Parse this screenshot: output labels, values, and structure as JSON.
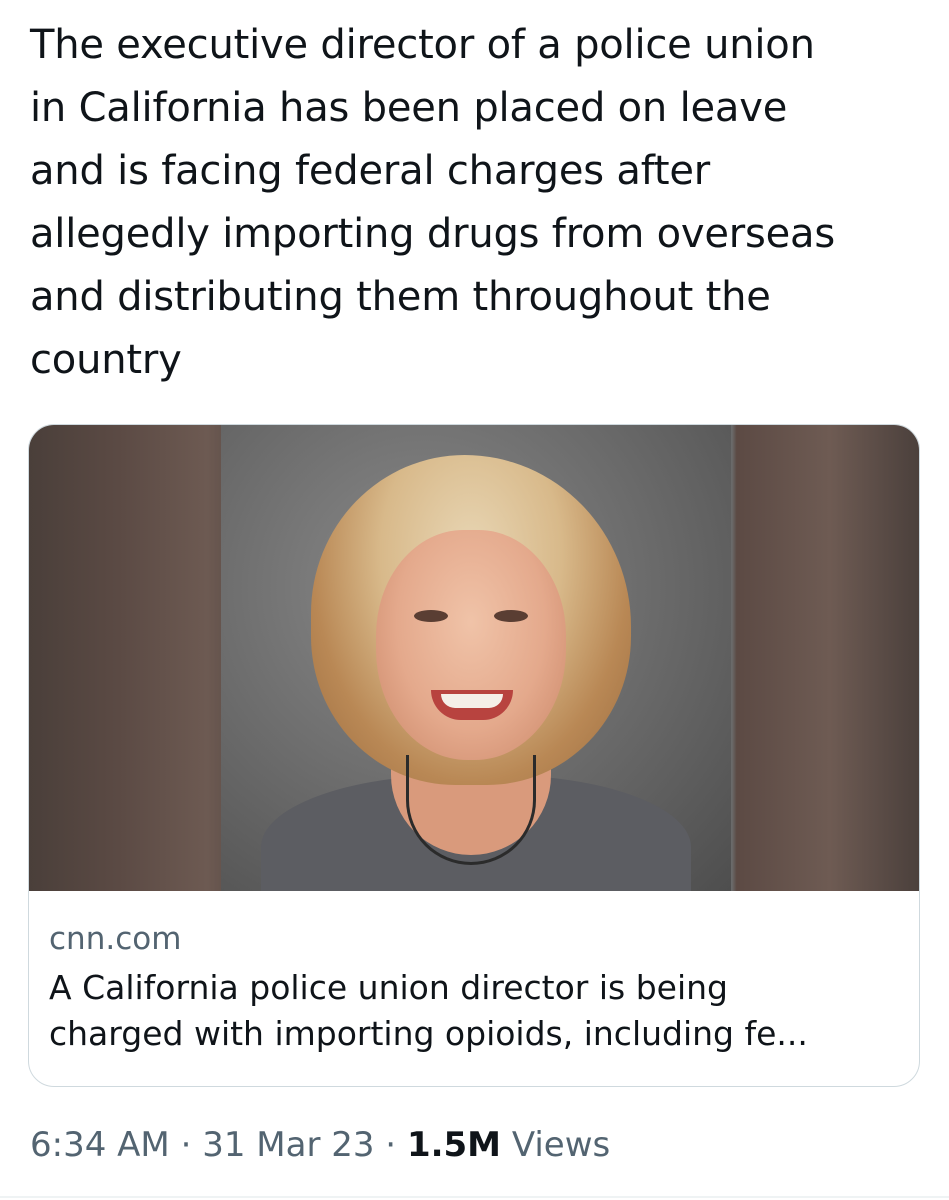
{
  "tweet": {
    "text_lines": [
      "The executive director of a police union",
      "in California has been placed on leave",
      "and is facing federal charges after",
      "allegedly importing drugs from overseas",
      "and distributing them throughout the",
      "country"
    ]
  },
  "card": {
    "domain": "cnn.com",
    "title_lines": [
      "A California police union director is being",
      "charged with importing opioids, including fe..."
    ]
  },
  "meta": {
    "time": "6:34 AM",
    "sep1": " · ",
    "date": "31 Mar 23",
    "sep2": " · ",
    "views_count": "1.5M",
    "views_label": " Views"
  },
  "colors": {
    "text_primary": "#0f1419",
    "text_secondary": "#536471",
    "card_border": "#cfd9de"
  }
}
